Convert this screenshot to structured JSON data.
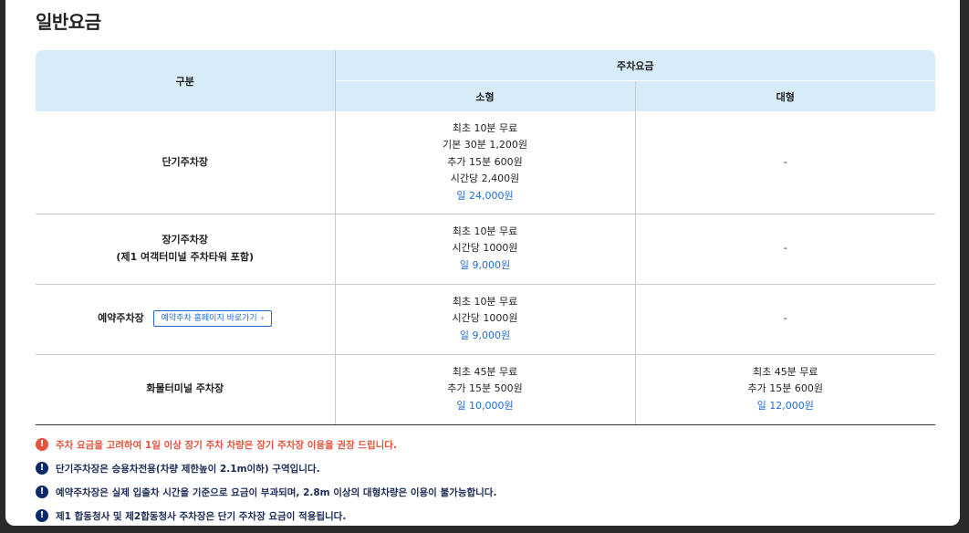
{
  "page": {
    "title": "일반요금"
  },
  "table": {
    "header": {
      "category": "구분",
      "fee": "주차요금",
      "small": "소형",
      "large": "대형"
    },
    "rows": [
      {
        "name": "단기주차장",
        "small": [
          "최초 10분 무료",
          "기본 30분 1,200원",
          "추가 15분 600원",
          "시간당 2,400원"
        ],
        "small_daily": "일 24,000원",
        "large": "-"
      },
      {
        "name": "장기주차장",
        "name_sub": "(제1 여객터미널 주차타워 포함)",
        "small": [
          "최초 10분 무료",
          "시간당 1000원"
        ],
        "small_daily": "일 9,000원",
        "large": "-"
      },
      {
        "name": "예약주차장",
        "button": "예약주차 홈페이지 바로가기",
        "button_arrow": "›",
        "small": [
          "최초 10분 무료",
          "시간당 1000원"
        ],
        "small_daily": "일 9,000원",
        "large": "-"
      },
      {
        "name": "화물터미널 주차장",
        "small": [
          "최초 45분 무료",
          "추가 15분 500원"
        ],
        "small_daily": "일 10,000원",
        "large": [
          "최초 45분 무료",
          "추가 15분 600원"
        ],
        "large_daily": "일 12,000원"
      }
    ]
  },
  "notes": [
    {
      "icon": "!",
      "text": "주차 요금을 고려하여 1일 이상 장기 주차 차량은 장기 주차장 이용을 권장 드립니다.",
      "color": "#e5533d"
    },
    {
      "icon": "!",
      "text": "단기주차장은 승용차전용(차량 제한높이 2.1m이하) 구역입니다.",
      "color": "#0b2a6b"
    },
    {
      "icon": "!",
      "text": "예약주차장은 실제 입출차 시간을 기준으로 요금이 부과되며, 2.8m 이상의 대형차량은 이용이 불가능합니다.",
      "color": "#0b2a6b"
    },
    {
      "icon": "!",
      "text": "제1 합동청사 및 제2합동청사 주차장은 단기 주차장 요금이 적용됩니다.",
      "color": "#0b2a6b"
    }
  ]
}
